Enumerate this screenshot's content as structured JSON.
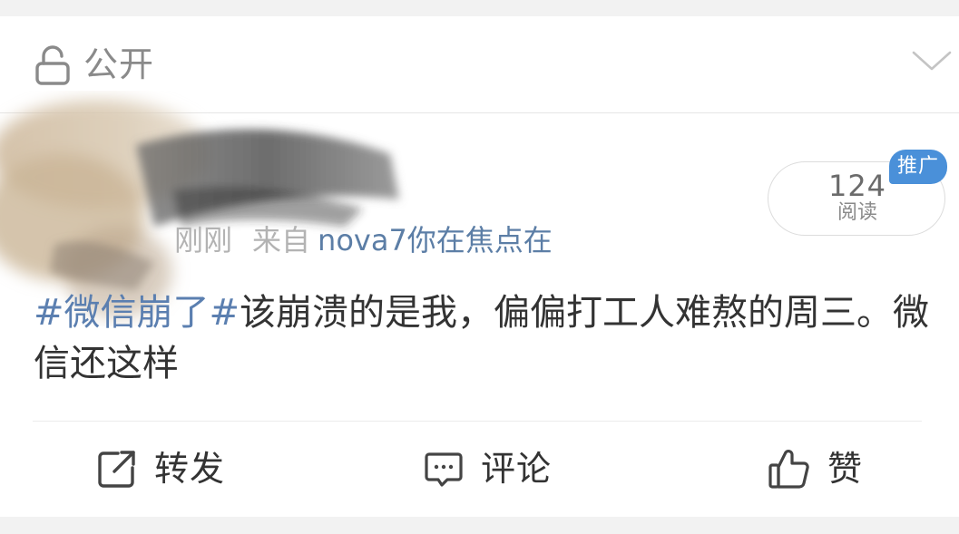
{
  "header": {
    "visibility_label": "公开"
  },
  "meta": {
    "time": "刚刚",
    "from_prefix": "来自",
    "source": "nova7你在焦点在"
  },
  "stats": {
    "read_count": "124",
    "read_label": "阅读",
    "promo_badge": "推广"
  },
  "post": {
    "hashtag": "#微信崩了#",
    "text": "该崩溃的是我，偏偏打工人难熬的周三。微信还这样"
  },
  "actions": {
    "repost_label": "转发",
    "comment_label": "评论",
    "like_label": "赞"
  },
  "colors": {
    "hashtag": "#5b7fb0",
    "source_link": "#5c7ea6",
    "badge": "#4a90d9"
  }
}
